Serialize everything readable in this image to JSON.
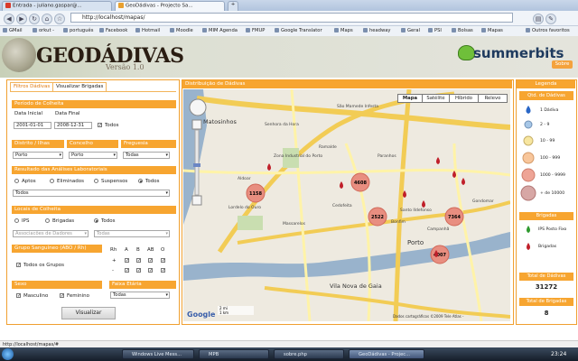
{
  "browser": {
    "tabs": [
      {
        "label": "Entrada - juliano.gaspar@...",
        "active": false
      },
      {
        "label": "GeoDádivas - Projecto Sa...",
        "active": true
      }
    ],
    "url": "http://localhost/mapas/",
    "bookmarks": [
      "GMail",
      "orkut -",
      "português",
      "Facebook",
      "Hotmail",
      "Moodle",
      "MIM Agenda",
      "FMUP",
      "Google Translator",
      "Maps",
      "headway",
      "Geral",
      "PSI",
      "Bolsas",
      "Mapas"
    ],
    "other_bookmarks": "Outros favoritos",
    "status": "http://localhost/mapas/#"
  },
  "header": {
    "logo": "GEODÁDIVAS",
    "version": "Versão 1.0",
    "brand": "summerbits",
    "sobre": "Sobre"
  },
  "filters": {
    "tabs": [
      "Filtros Dádivas",
      "Visualizar Brigadas"
    ],
    "periodo": {
      "title": "Período de Colheita",
      "data_inicial_label": "Data Inicial",
      "data_final_label": "Data Final",
      "data_inicial": "2001-01-01",
      "data_final": "2008-12-31",
      "todos": "Todos"
    },
    "local": {
      "distrito_label": "Distrito / Ilhas",
      "concelho_label": "Concelho",
      "freguesia_label": "Freguesia",
      "distrito": "Porto",
      "concelho": "Porto",
      "freguesia": "Todas"
    },
    "analises": {
      "title": "Resultado das Análises Laboratoriais",
      "options": [
        "Aptos",
        "Eliminados",
        "Suspensos",
        "Todos"
      ],
      "selected": "Todos",
      "select_value": "Todos"
    },
    "locais": {
      "title": "Locais de Colheita",
      "options": [
        "IPS",
        "Brigadas",
        "Todos"
      ],
      "selected": "Todos",
      "assoc_placeholder": "Associacões de Dadores",
      "assoc_value": "Todas"
    },
    "grupo": {
      "title": "Grupo Sanguíneo (ABO / Rh)",
      "todos": "Todos os Grupos",
      "columns": [
        "Rh",
        "A",
        "B",
        "AB",
        "O"
      ],
      "rows": [
        "+",
        "-"
      ]
    },
    "sexo": {
      "title": "Sexo",
      "masculino": "Masculino",
      "feminino": "Feminino"
    },
    "faixa": {
      "title": "Faixa Etária",
      "value": "Todas"
    },
    "button": "Visualizar"
  },
  "map": {
    "title": "Distribuição de Dádivas",
    "types": [
      "Mapa",
      "Satélite",
      "Híbrido",
      "Relevo"
    ],
    "active_type": "Mapa",
    "places": [
      "Matosinhos",
      "Zona Industrial do Porto",
      "Lordelo do Ouro",
      "Massarelos",
      "Paranhos",
      "Campanhã",
      "Bonfim",
      "Porto",
      "Vila Nova de Gaia",
      "Senhora da Hora",
      "Ramalde",
      "Aldoar",
      "São Mamede Infesta",
      "Santo Ildefonso",
      "Cedofeita",
      "Gondomar"
    ],
    "clusters": [
      "1158",
      "4608",
      "2522",
      "7364",
      "4007"
    ],
    "scale": [
      "2 mi",
      "1 km"
    ],
    "copyright": "Dados cartográficos ©2009 Tele Atlas - "
  },
  "legend": {
    "title": "Legenda",
    "qtd_title": "Qtd. de Dádivas",
    "levels": [
      "1 Dádiva",
      "2 - 9",
      "10 - 99",
      "100 - 999",
      "1000 - 9999",
      "+ de 10000"
    ],
    "brigadas_title": "Brigadas",
    "ips_label": "IPS Posto Fixo",
    "brigadas_label": "Brigadas",
    "total_dadivas_label": "Total de Dádivas",
    "total_dadivas": "31272",
    "total_brigadas_label": "Total de Brigadas",
    "total_brigadas": "8",
    "colors": {
      "accent": "#f7a530",
      "drop": "#c0202a",
      "ips": "#2f9a2f"
    }
  },
  "taskbar": {
    "items": [
      "Windows Live Mess...",
      "MPB",
      "sobre.php",
      "GeoDádivas - Projec..."
    ],
    "clock": "23:24"
  }
}
